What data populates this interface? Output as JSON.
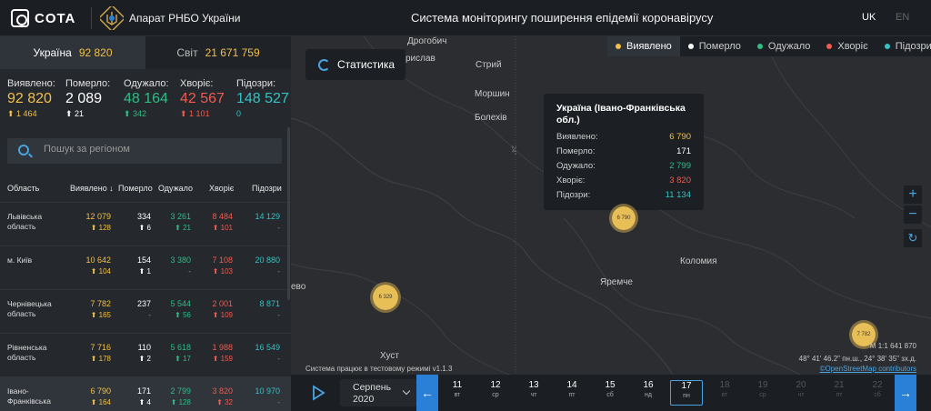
{
  "header": {
    "logo_text": "COTA",
    "org_name": "Апарат РНБО України",
    "system_title": "Система моніторингу поширення епідемії коронавірусу",
    "lang_active": "UK",
    "lang_inactive": "EN"
  },
  "sidebar": {
    "tab_ukraine": {
      "label": "Україна",
      "value": "92 820"
    },
    "tab_world": {
      "label": "Світ",
      "value": "21 671 759"
    },
    "totals": [
      {
        "label": "Виявлено:",
        "value": "92 820",
        "delta": "1 464"
      },
      {
        "label": "Померло:",
        "value": "2 089",
        "delta": "21"
      },
      {
        "label": "Одужало:",
        "value": "48 164",
        "delta": "342"
      },
      {
        "label": "Хворіє:",
        "value": "42 567",
        "delta": "1 101"
      },
      {
        "label": "Підозри:",
        "value": "148 527",
        "delta": "0"
      }
    ],
    "search_placeholder": "Пошук за регіоном",
    "table_headers": {
      "region": "Область",
      "confirmed": "Виявлено",
      "dead": "Померло",
      "recovered": "Одужало",
      "sick": "Хворіє",
      "suspected": "Підозри"
    },
    "rows": [
      {
        "region": "Львівська область",
        "confirmed": "12 079",
        "confirmed_d": "128",
        "dead": "334",
        "dead_d": "6",
        "recovered": "3 261",
        "recovered_d": "21",
        "sick": "8 484",
        "sick_d": "101",
        "suspected": "14 129",
        "suspected_d": "-"
      },
      {
        "region": "м. Київ",
        "confirmed": "10 642",
        "confirmed_d": "104",
        "dead": "154",
        "dead_d": "1",
        "recovered": "3 380",
        "recovered_d": "-",
        "sick": "7 108",
        "sick_d": "103",
        "suspected": "20 880",
        "suspected_d": "-"
      },
      {
        "region": "Чернівецька область",
        "confirmed": "7 782",
        "confirmed_d": "165",
        "dead": "237",
        "dead_d": "-",
        "recovered": "5 544",
        "recovered_d": "56",
        "sick": "2 001",
        "sick_d": "109",
        "suspected": "8 871",
        "suspected_d": "-"
      },
      {
        "region": "Рівненська область",
        "confirmed": "7 716",
        "confirmed_d": "178",
        "dead": "110",
        "dead_d": "2",
        "recovered": "5 618",
        "recovered_d": "17",
        "sick": "1 988",
        "sick_d": "159",
        "suspected": "16 549",
        "suspected_d": "-"
      },
      {
        "region": "Івано-Франківська",
        "confirmed": "6 790",
        "confirmed_d": "164",
        "dead": "171",
        "dead_d": "4",
        "recovered": "2 799",
        "recovered_d": "128",
        "sick": "3 820",
        "sick_d": "32",
        "suspected": "10 970",
        "suspected_d": "-"
      }
    ]
  },
  "map": {
    "stats_button": "Статистика",
    "legend": [
      "Виявлено",
      "Померло",
      "Одужало",
      "Хворіє",
      "Підозри"
    ],
    "legend_colors": [
      "#f2c046",
      "#ffffff",
      "#2ebd85",
      "#f05a4f",
      "#35c2c2"
    ],
    "places": [
      "Дрогобич",
      "Стрий",
      "Моршин",
      "Болехів",
      "Коломия",
      "Яремче",
      "Хуст",
      "рислав",
      "ево"
    ],
    "tooltip": {
      "title": "Україна (Івано-Франківська обл.)",
      "rows": [
        {
          "label": "Виявлено:",
          "value": "6 790"
        },
        {
          "label": "Померло:",
          "value": "171"
        },
        {
          "label": "Одужало:",
          "value": "2 799"
        },
        {
          "label": "Хворіє:",
          "value": "3 820"
        },
        {
          "label": "Підозри:",
          "value": "11 134"
        }
      ]
    },
    "clusters": [
      "6 790",
      "6 329",
      "7 782"
    ],
    "grid_label": "24°",
    "scale": "М 1:1 641 870",
    "coords": "48° 41' 46.2\" пн.ш., 24° 38' 35\" зх.д.",
    "osm": "©OpenStreetMap contributors",
    "test_mode": "Система працює в тестовому режимі v1.1.3",
    "icons": [
      "chart-icon",
      "zoom-in-icon",
      "zoom-out-icon",
      "refresh-icon"
    ]
  },
  "timeline": {
    "month": "Серпень",
    "year": "2020",
    "days": [
      {
        "n": "11",
        "w": "вт"
      },
      {
        "n": "12",
        "w": "ср"
      },
      {
        "n": "13",
        "w": "чт"
      },
      {
        "n": "14",
        "w": "пт"
      },
      {
        "n": "15",
        "w": "сб"
      },
      {
        "n": "16",
        "w": "нд"
      },
      {
        "n": "17",
        "w": "пн"
      },
      {
        "n": "18",
        "w": "вт"
      },
      {
        "n": "19",
        "w": "ср"
      },
      {
        "n": "20",
        "w": "чт"
      },
      {
        "n": "21",
        "w": "пт"
      },
      {
        "n": "22",
        "w": "сб"
      }
    ],
    "selected_day": "17"
  }
}
